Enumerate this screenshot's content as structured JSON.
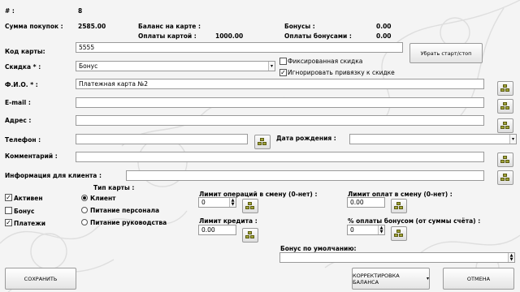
{
  "header": {
    "num_label": "#  :",
    "num_value": "8",
    "purchase_sum_label": "Сумма покупок :",
    "purchase_sum_value": "2585.00",
    "card_balance_label": "Баланс на карте :",
    "card_payments_label": "Оплаты картой :",
    "card_payments_value": "1000.00",
    "bonuses_label": "Бонусы :",
    "bonuses_value": "0.00",
    "bonus_payments_label": "Оплаты бонусами :",
    "bonus_payments_value": "0.00"
  },
  "form": {
    "card_code_label": "Код карты:",
    "card_code_value": "5555",
    "start_stop_label": "Убрать старт/стоп",
    "discount_label": "Скидка * :",
    "discount_value": "Бонус",
    "fixed_discount_label": "Фиксированная скидка",
    "ignore_binding_label": "Игнорировать привязку к скидке",
    "fio_label": "Ф.И.О. * :",
    "fio_value": "Платежная карта №2",
    "email_label": "E-mail :",
    "address_label": "Адрес :",
    "phone_label": "Телефон :",
    "birthdate_label": "Дата рождения :",
    "comment_label": "Комментарий :",
    "client_info_label": "Информация для клиента :"
  },
  "flags": {
    "active_label": "Активен",
    "bonus_label": "Бонус",
    "payments_label": "Платежи"
  },
  "card_type": {
    "title": "Тип карты :",
    "client": "Клиент",
    "staff_food": "Питание персонала",
    "management_food": "Питание руководства"
  },
  "limits": {
    "ops_limit_label": "Лимит операций в смену (0-нет) :",
    "ops_limit_value": "0",
    "pay_limit_label": "Лимит оплат в смену (0-нет) :",
    "pay_limit_value": "0.00",
    "credit_limit_label": "Лимит кредита :",
    "credit_limit_value": "0.00",
    "bonus_pct_label": "% оплаты бонусом (от суммы счёта) :",
    "bonus_pct_value": "0",
    "default_bonus_label": "Бонус по умолчанию:"
  },
  "buttons": {
    "save": "СОХРАНИТЬ",
    "balance_adjust": "КОРРЕКТИРОВКА БАЛАНСА",
    "cancel": "ОТМЕНА"
  },
  "colors": {
    "icon_green": "#a1a53a"
  }
}
